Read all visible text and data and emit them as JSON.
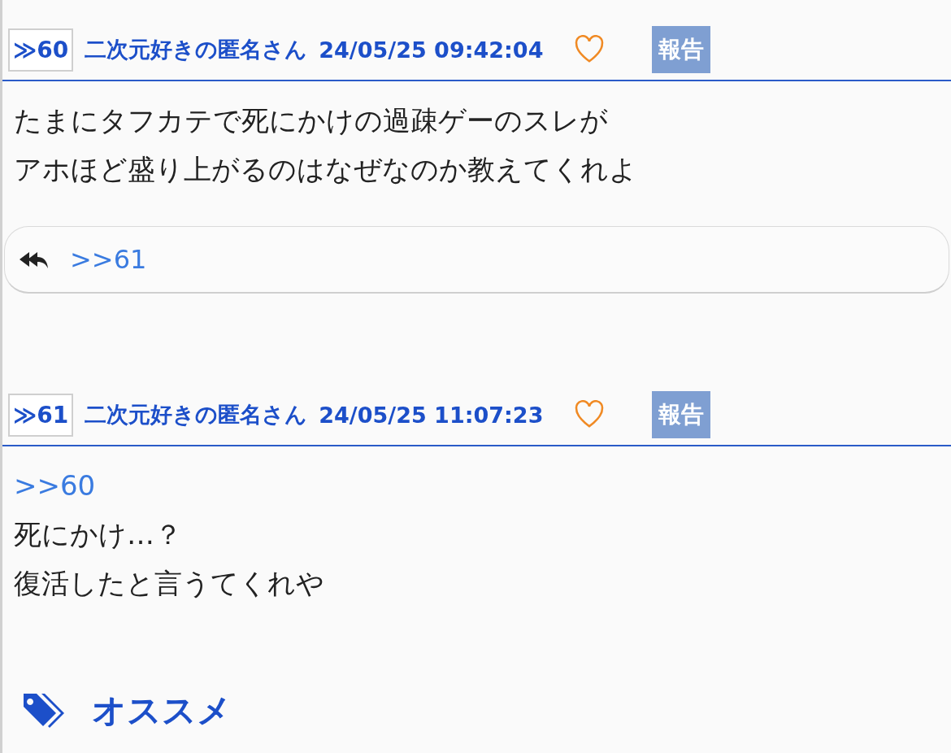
{
  "posts": [
    {
      "number": "≫60",
      "name": "二次元好きの匿名さん",
      "date": "24/05/25 09:42:04",
      "liked": false,
      "report": "報告",
      "body": [
        {
          "kind": "text",
          "text": "たまにタフカテで死にかけの過疎ゲーのスレが"
        },
        {
          "kind": "text",
          "text": "アホほど盛り上がるのはなぜなのか教えてくれよ"
        }
      ],
      "replies": [
        ">>61"
      ]
    },
    {
      "number": "≫61",
      "name": "二次元好きの匿名さん",
      "date": "24/05/25 11:07:23",
      "liked": false,
      "report": "報告",
      "body": [
        {
          "kind": "link",
          "text": ">>60"
        },
        {
          "kind": "text",
          "text": "死にかけ…？"
        },
        {
          "kind": "text",
          "text": "復活したと言うてくれや"
        }
      ]
    }
  ],
  "recommend": {
    "title": "オススメ"
  }
}
